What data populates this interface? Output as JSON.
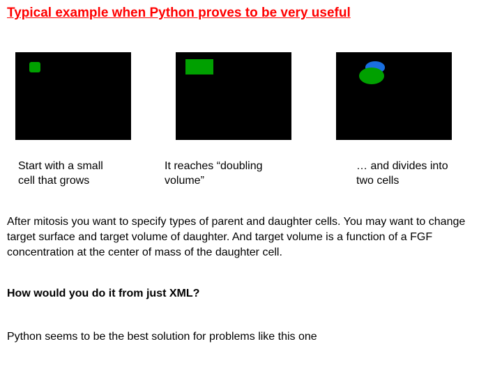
{
  "title": "Typical example when Python proves to be very useful",
  "panels": [
    {
      "caption": "Start with a small cell that grows"
    },
    {
      "caption": "It reaches “doubling volume”"
    },
    {
      "caption": "… and divides into two cells"
    }
  ],
  "paragraph": "After mitosis you want to specify types of parent and daughter cells. You may want to change target surface and target volume of daughter.  And target volume is a function of a FGF concentration at the center of mass of the daughter cell.",
  "question": "How would you do it from just XML?",
  "answer": "Python seems to be the best solution for problems like this one"
}
